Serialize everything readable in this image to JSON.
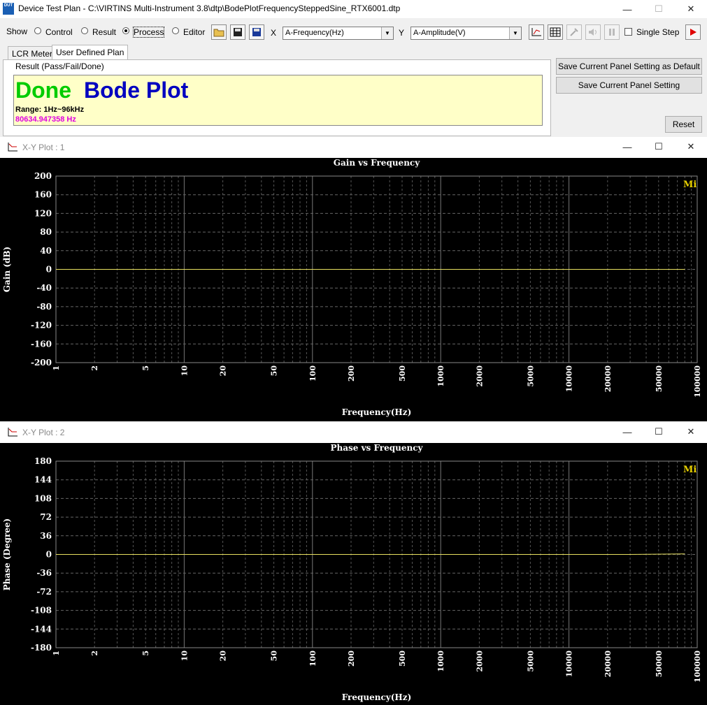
{
  "window": {
    "app_icon_text": "DUT",
    "title": "Device Test Plan - C:\\VIRTINS Multi-Instrument 3.8\\dtp\\BodePlotFrequencySteppedSine_RTX6001.dtp",
    "minimize": "—",
    "maximize": "☐",
    "close": "✕"
  },
  "toolbar": {
    "show_label": "Show",
    "radios": [
      {
        "label": "Control",
        "checked": false
      },
      {
        "label": "Result",
        "checked": false
      },
      {
        "label": "Process",
        "checked": true
      },
      {
        "label": "Editor",
        "checked": false
      }
    ],
    "x_label": "X",
    "x_value": "A-Frequency(Hz)",
    "y_label": "Y",
    "y_value": "A-Amplitude(V)",
    "single_step_label": "Single Step"
  },
  "tabs": [
    {
      "label": "LCR Meter",
      "active": false
    },
    {
      "label": "User Defined Plan",
      "active": true
    }
  ],
  "result": {
    "heading": "Result (Pass/Fail/Done)",
    "status": "Done",
    "status_color": "#00cc00",
    "plot_name": "Bode Plot",
    "plot_color": "#0000c0",
    "range": "Range: 1Hz~96kHz",
    "freq": "80634.947358 Hz",
    "freq_color": "#e000e0"
  },
  "buttons": {
    "save_default": "Save Current Panel Setting as Default",
    "save": "Save Current Panel Setting",
    "reset": "Reset"
  },
  "plots": [
    {
      "window_title": "X-Y Plot : 1",
      "chart_title": "Gain vs Frequency",
      "ylabel": "Gain (dB)",
      "xlabel": "Frequency(Hz)",
      "yticks": [
        "200",
        "160",
        "120",
        "80",
        "40",
        "0",
        "-40",
        "-80",
        "-120",
        "-160",
        "-200"
      ],
      "xticks": [
        "1",
        "2",
        "5",
        "10",
        "20",
        "50",
        "100",
        "200",
        "500",
        "1000",
        "2000",
        "5000",
        "10000",
        "20000",
        "50000",
        "100000"
      ],
      "logo": "Mi"
    },
    {
      "window_title": "X-Y Plot : 2",
      "chart_title": "Phase vs Frequency",
      "ylabel": "Phase (Degree)",
      "xlabel": "Frequency(Hz)",
      "yticks": [
        "180",
        "144",
        "108",
        "72",
        "36",
        "0",
        "-36",
        "-72",
        "-108",
        "-144",
        "-180"
      ],
      "xticks": [
        "1",
        "2",
        "5",
        "10",
        "20",
        "50",
        "100",
        "200",
        "500",
        "1000",
        "2000",
        "5000",
        "10000",
        "20000",
        "50000",
        "100000"
      ],
      "logo": "Mi"
    }
  ],
  "chart_data": [
    {
      "type": "line",
      "title": "Gain vs Frequency",
      "xlabel": "Frequency(Hz)",
      "ylabel": "Gain (dB)",
      "xscale": "log",
      "xlim": [
        1,
        100000
      ],
      "ylim": [
        -200,
        200
      ],
      "grid": true,
      "series": [
        {
          "color": "#e8e060",
          "x": [
            1,
            10,
            100,
            1000,
            10000,
            80000
          ],
          "y": [
            0,
            0,
            0,
            0,
            0,
            0
          ]
        }
      ]
    },
    {
      "type": "line",
      "title": "Phase vs Frequency",
      "xlabel": "Frequency(Hz)",
      "ylabel": "Phase (Degree)",
      "xscale": "log",
      "xlim": [
        1,
        100000
      ],
      "ylim": [
        -180,
        180
      ],
      "grid": true,
      "series": [
        {
          "color": "#e8e060",
          "x": [
            1,
            10,
            100,
            1000,
            10000,
            30000,
            80000
          ],
          "y": [
            0,
            0,
            0,
            0,
            0,
            0,
            1
          ]
        }
      ]
    }
  ]
}
